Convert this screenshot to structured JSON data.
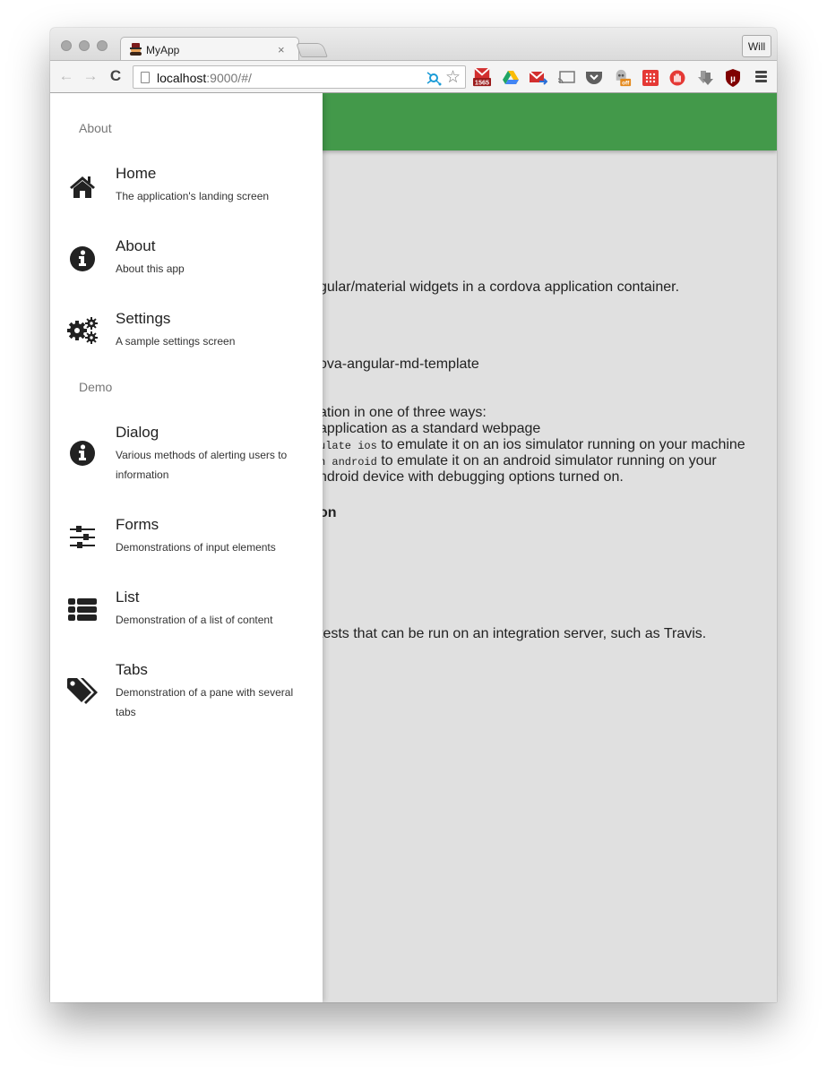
{
  "browser": {
    "tab": {
      "title": "MyApp",
      "close_glyph": "×"
    },
    "profile_label": "Will",
    "nav": {
      "back_glyph": "←",
      "forward_glyph": "→",
      "reload_glyph": "C"
    },
    "url": {
      "host": "localhost",
      "rest": ":9000/#/"
    },
    "star_glyph": "☆",
    "extensions": [
      {
        "name": "gmail-checker-icon",
        "badge": "1565",
        "color": "#d22e2e"
      },
      {
        "name": "google-drive-icon",
        "color": "#1fa463"
      },
      {
        "name": "gmail-send-icon",
        "color": "#d22e2e"
      },
      {
        "name": "cast-icon",
        "color": "#777777"
      },
      {
        "name": "pocket-icon",
        "color": "#5f5f5f"
      },
      {
        "name": "ghostery-icon",
        "badge": "off",
        "color": "#e48a1e"
      },
      {
        "name": "grid-app-icon",
        "color": "#e53935"
      },
      {
        "name": "adblock-icon",
        "color": "#e53935"
      },
      {
        "name": "download-icon",
        "color": "#8a8a8a"
      },
      {
        "name": "ublock-icon",
        "badge": "µ",
        "color": "#800000"
      }
    ]
  },
  "sidenav": {
    "sections": [
      {
        "header": "About",
        "items": [
          {
            "title": "Home",
            "description": "The application's landing screen",
            "icon": "home-icon"
          },
          {
            "title": "About",
            "description": "About this app",
            "icon": "info-icon"
          },
          {
            "title": "Settings",
            "description": "A sample settings screen",
            "icon": "gears-icon"
          }
        ]
      },
      {
        "header": "Demo",
        "items": [
          {
            "title": "Dialog",
            "description": "Various methods of alerting users to information",
            "icon": "info-icon"
          },
          {
            "title": "Forms",
            "description": "Demonstrations of input elements",
            "icon": "sliders-icon"
          },
          {
            "title": "List",
            "description": "Demonstration of a list of content",
            "icon": "list-icon"
          },
          {
            "title": "Tabs",
            "description": "Demonstration of a pane with several tabs",
            "icon": "tags-icon"
          }
        ]
      }
    ]
  },
  "main": {
    "lines": [
      {
        "text": "gular/material widgets in a cordova application container."
      },
      {
        "text": "ova-angular-md-template"
      },
      {
        "text": "ation in one of three ways:"
      },
      {
        "text": " application as a standard webpage"
      },
      {
        "code": "ulate ios",
        "text": " to emulate it on an ios simulator running on your machine"
      },
      {
        "code": "n android",
        "text": " to emulate it on an android simulator running on your"
      },
      {
        "text": "ndroid device with debugging options turned on."
      },
      {
        "text": "on",
        "bold": true
      },
      {
        "text": " tests that can be run on an integration server, such as Travis."
      }
    ]
  },
  "colors": {
    "appbar": "#43994a",
    "page_bg": "#e0e0e0"
  }
}
